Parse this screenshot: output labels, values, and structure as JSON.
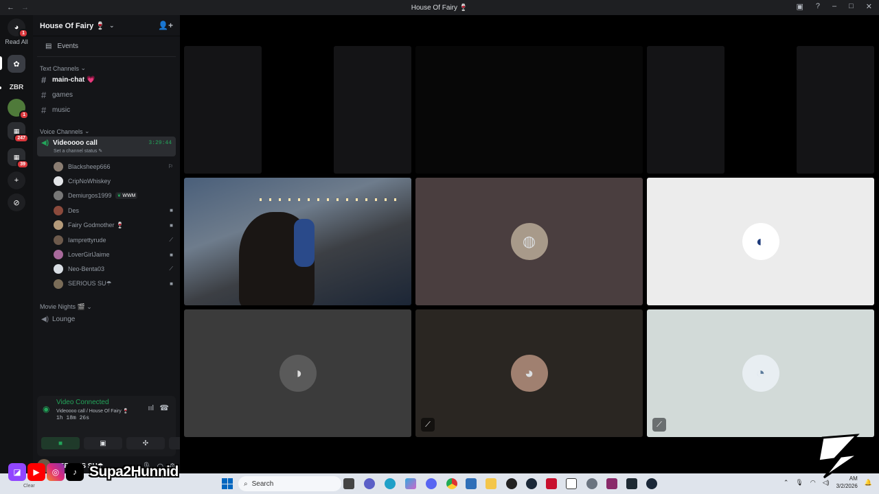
{
  "titlebar": {
    "title": "House Of Fairy 🍷",
    "back": "←",
    "forward": "→"
  },
  "rail": {
    "read_all": "Read All",
    "badges": [
      "1",
      "1",
      "247",
      "39"
    ]
  },
  "server": {
    "name": "House Of Fairy 🍷"
  },
  "events_label": "Events",
  "text_category": "Text Channels",
  "text_channels": [
    "main-chat 💗",
    "games",
    "music"
  ],
  "voice_category": "Voice Channels",
  "voice_channel": {
    "name": "Videoooo call",
    "timer": "3:29:44",
    "status": "Set a channel status"
  },
  "members": [
    {
      "name": "Blacksheep666",
      "color": "#8a7d72",
      "icon": "⚐"
    },
    {
      "name": "CripNoWhiskey",
      "color": "#e3e5e8",
      "icon": ""
    },
    {
      "name": "Demiurgos1999",
      "color": "#777777",
      "icon": "",
      "tag": "WWM"
    },
    {
      "name": "Des",
      "color": "#8b4a3c",
      "icon": "■"
    },
    {
      "name": "Fairy Godmother 🍷",
      "color": "#b49a7a",
      "icon": "■"
    },
    {
      "name": "Iamprettyrude",
      "color": "#6d5a4c",
      "icon": "⟋"
    },
    {
      "name": "LoverGirlJaime",
      "color": "#a86a9c",
      "icon": "■"
    },
    {
      "name": "Neo-Benta03",
      "color": "#d8dde3",
      "icon": "⟋"
    },
    {
      "name": "SERIOUS SU☂",
      "color": "#7a6c58",
      "icon": "■"
    }
  ],
  "movie_category": "Movie Nights 🎬",
  "movie_channels": [
    "Lounge"
  ],
  "voice_panel": {
    "status": "Video Connected",
    "location": "Videoooo call / House Of Fairy 🍷",
    "duration": "1h 18m 26s"
  },
  "user": {
    "name": "SERIOUS SU☂"
  },
  "overlay": {
    "handle": "Supa2Hunnid",
    "clear": "Clear"
  },
  "taskbar": {
    "search": "Search",
    "time": "AM",
    "date": "3/2/2026"
  },
  "colors": {
    "accent_green": "#23a55a",
    "rail": "#111214",
    "sidebar": "#141518"
  }
}
